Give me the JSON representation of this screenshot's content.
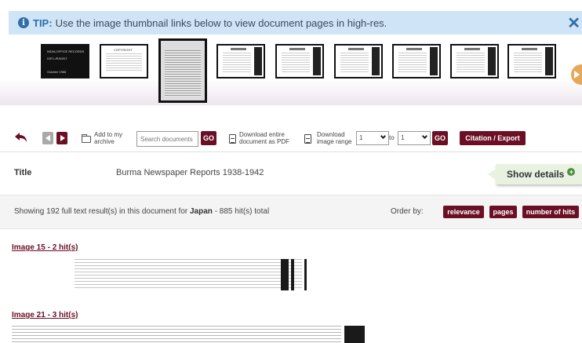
{
  "tip": {
    "label": "TIP:",
    "text": "Use the image thumbnail links below to view document pages in high-res.",
    "close": "✕"
  },
  "thumbnail_1": {
    "lines": [
      "INDIA OFFICE RECORDS",
      "IOR L/R/5/207",
      "October 1966"
    ]
  },
  "thumbnail_2": {
    "title": "COPYRIGHT"
  },
  "toolbar": {
    "add_to_archive": "Add to my archive",
    "search_placeholder": "Search documents",
    "go": "GO",
    "download_pdf": "Download entire document as PDF",
    "download_range": "Download image range",
    "range_from": "1",
    "to": "to",
    "range_to": "1",
    "citation": "Citation / Export"
  },
  "title_label": "Title",
  "title_value": "Burma Newspaper Reports 1938-1942",
  "show_details": "Show details",
  "results": {
    "prefix": "Showing 192 full text result(s) in this document for",
    "term": "Japan",
    "suffix": "- 885 hit(s) total",
    "order_label": "Order by:",
    "order_options": [
      "relevance",
      "pages",
      "number of hits"
    ]
  },
  "hits": [
    {
      "label": "Image 15 - 2 hit(s)"
    },
    {
      "label": "Image 21 - 3 hit(s)"
    }
  ],
  "colors": {
    "accent": "#6b0f24",
    "tip_bg": "#cfe4f6",
    "tip_text": "#2f6ea8",
    "details_bg": "#e9f2e1"
  }
}
